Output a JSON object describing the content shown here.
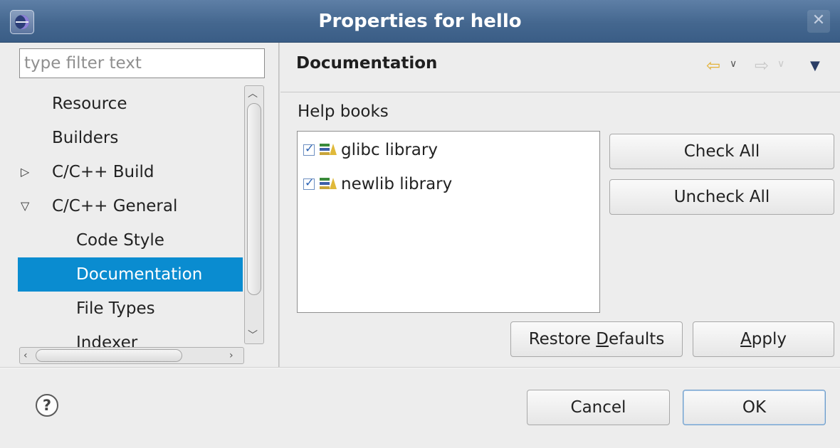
{
  "window": {
    "title": "Properties for hello",
    "close_glyph": "✕"
  },
  "left": {
    "filter_placeholder": "type filter text",
    "tree": [
      {
        "label": "Resource",
        "twisty": "",
        "indent": 0,
        "selected": false
      },
      {
        "label": "Builders",
        "twisty": "",
        "indent": 0,
        "selected": false
      },
      {
        "label": "C/C++ Build",
        "twisty": "collapsed",
        "indent": 0,
        "selected": false
      },
      {
        "label": "C/C++ General",
        "twisty": "expanded",
        "indent": 0,
        "selected": false
      },
      {
        "label": "Code Style",
        "twisty": "",
        "indent": 1,
        "selected": false
      },
      {
        "label": "Documentation",
        "twisty": "",
        "indent": 1,
        "selected": true
      },
      {
        "label": "File Types",
        "twisty": "",
        "indent": 1,
        "selected": false
      },
      {
        "label": "Indexer",
        "twisty": "",
        "indent": 1,
        "selected": false
      }
    ]
  },
  "page": {
    "title": "Documentation",
    "help_books_label": "Help books",
    "books": [
      {
        "label": "glibc library",
        "checked": true
      },
      {
        "label": "newlib library",
        "checked": true
      }
    ],
    "check_all": "Check All",
    "uncheck_all": "Uncheck All",
    "restore_defaults": "Restore Defaults",
    "apply": "Apply"
  },
  "footer": {
    "help_glyph": "?",
    "cancel": "Cancel",
    "ok": "OK"
  },
  "colors": {
    "selection": "#0a8cd0",
    "titlebar": "#44678f"
  }
}
